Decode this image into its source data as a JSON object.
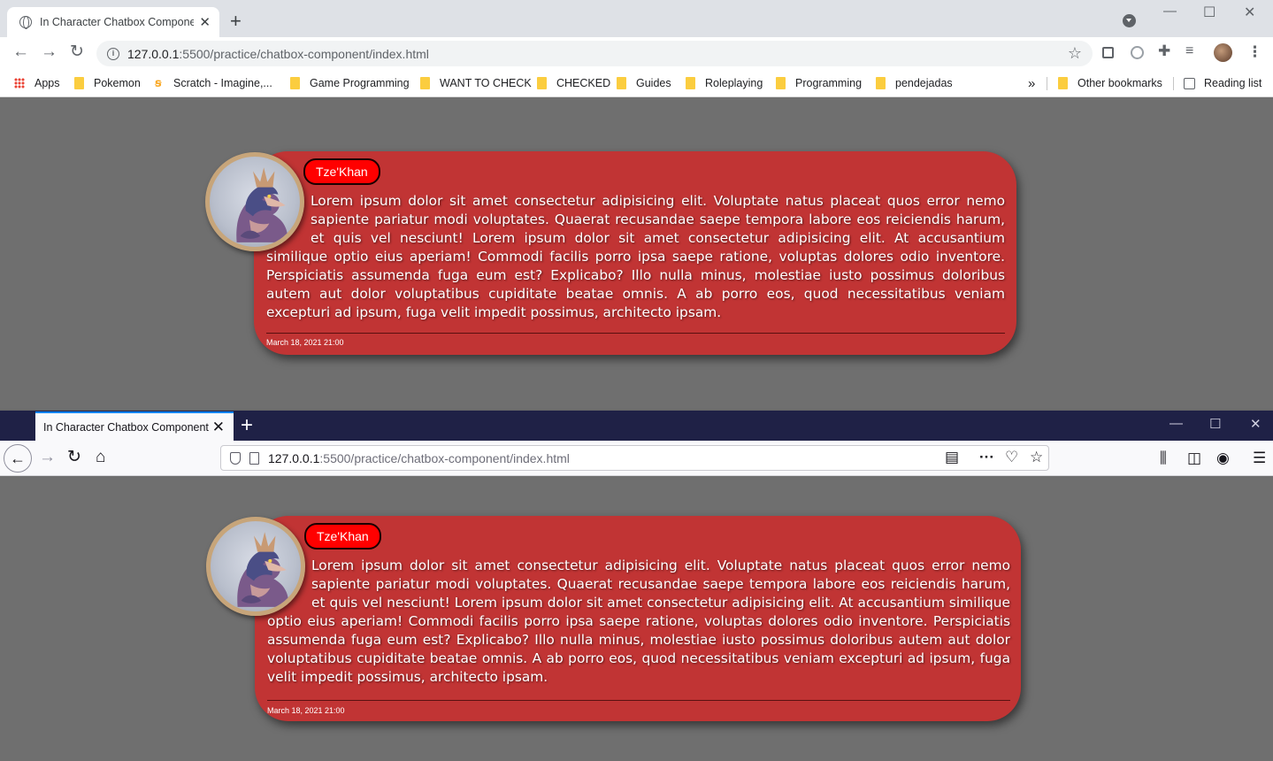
{
  "chrome": {
    "tab_title": "In Character Chatbox Component",
    "url_host": "127.0.0.1",
    "url_path": ":5500/practice/chatbox-component/index.html",
    "bookmarks": [
      {
        "label": "Apps",
        "icon": "apps-grid-icon"
      },
      {
        "label": "Pokemon",
        "icon": "folder-icon"
      },
      {
        "label": "Scratch - Imagine,...",
        "icon": "scratch-icon"
      },
      {
        "label": "Game Programming",
        "icon": "folder-icon"
      },
      {
        "label": "WANT TO CHECK",
        "icon": "folder-icon"
      },
      {
        "label": "CHECKED",
        "icon": "folder-icon"
      },
      {
        "label": "Guides",
        "icon": "folder-icon"
      },
      {
        "label": "Roleplaying",
        "icon": "folder-icon"
      },
      {
        "label": "Programming",
        "icon": "folder-icon"
      },
      {
        "label": "pendejadas",
        "icon": "folder-icon"
      }
    ],
    "overflow_label": "»",
    "other_bookmarks": "Other bookmarks",
    "reading_list": "Reading list"
  },
  "firefox": {
    "tab_title": "In Character Chatbox Component",
    "url_host": "127.0.0.1",
    "url_path": ":5500/practice/chatbox-component/index.html"
  },
  "chat": {
    "character_name": "Tze'Khan",
    "message": "Lorem ipsum dolor sit amet consectetur adipisicing elit. Voluptate natus placeat quos error nemo sapiente pariatur modi voluptates. Quaerat recusandae saepe tempora labore eos reiciendis harum, et quis vel nesciunt! Lorem ipsum dolor sit amet consectetur adipisicing elit. At accusantium similique optio eius aperiam! Commodi facilis porro ipsa saepe ratione, voluptas dolores odio inventore. Perspiciatis assumenda fuga eum est? Explicabo? Illo nulla minus, molestiae iusto possimus doloribus autem aut dolor voluptatibus cupiditate beatae omnis. A ab porro eos, quod necessitatibus veniam excepturi ad ipsum, fuga velit impedit possimus, architecto ipsam.",
    "timestamp": "March 18, 2021 21:00"
  },
  "colors": {
    "chatbox_bg": "#c13434",
    "name_badge_bg": "#ff0000",
    "avatar_border": "#c7a57a",
    "page_bg": "#6f6f6f"
  }
}
